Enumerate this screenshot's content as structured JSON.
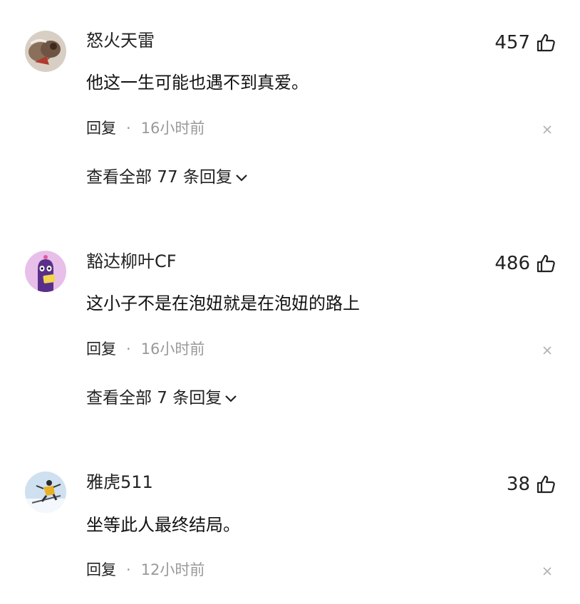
{
  "comments": [
    {
      "username": "怒火天雷",
      "likes": "457",
      "content": "他这一生可能也遇不到真爱。",
      "reply_label": "回复",
      "separator": "·",
      "time": "16小时前",
      "view_all": "查看全部 77 条回复"
    },
    {
      "username": "豁达柳叶CF",
      "likes": "486",
      "content": "这小子不是在泡妞就是在泡妞的路上",
      "reply_label": "回复",
      "separator": "·",
      "time": "16小时前",
      "view_all": "查看全部 7 条回复"
    },
    {
      "username": "雅虎511",
      "likes": "38",
      "content": "坐等此人最终结局。",
      "reply_label": "回复",
      "separator": "·",
      "time": "12小时前"
    }
  ],
  "icons": {
    "like": "thumbs-up-icon",
    "close": "close-icon",
    "expand": "chevron-down-icon"
  },
  "colors": {
    "text_primary": "#222222",
    "text_secondary": "#999999",
    "background": "#ffffff"
  }
}
